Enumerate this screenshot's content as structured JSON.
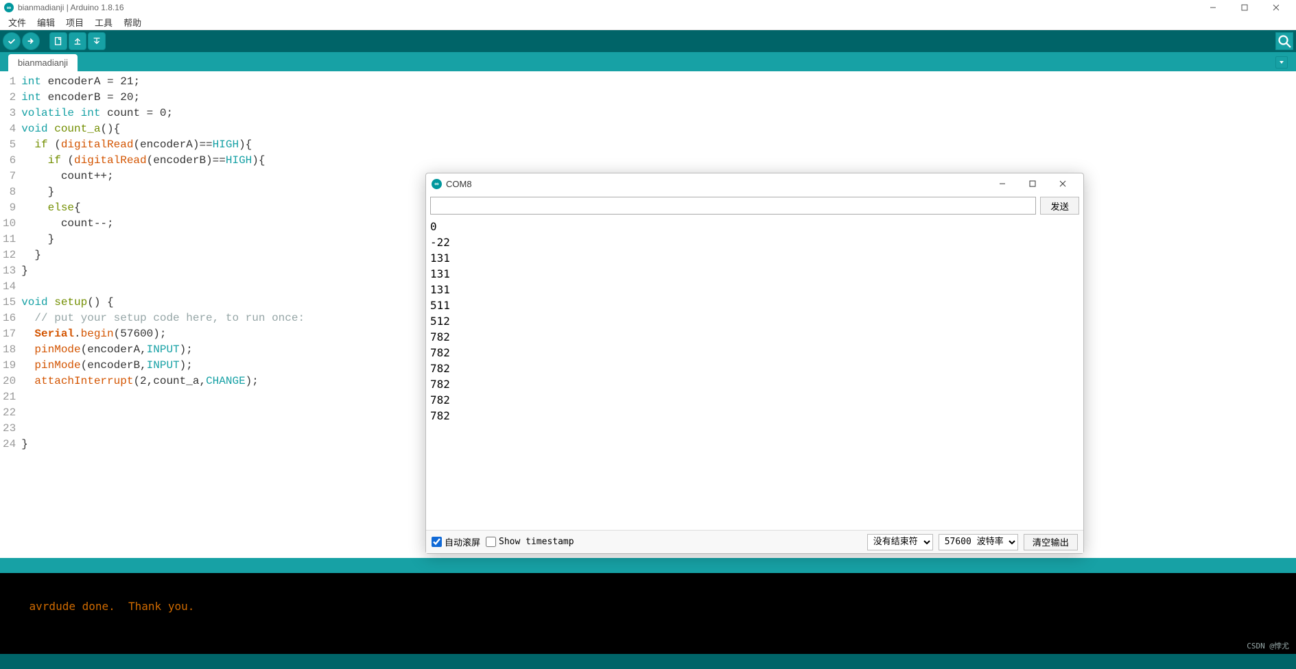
{
  "window": {
    "title": "bianmadianji | Arduino 1.8.16"
  },
  "menubar": {
    "file": "文件",
    "edit": "编辑",
    "sketch": "项目",
    "tools": "工具",
    "help": "帮助"
  },
  "toolbar_icons": {
    "verify": "verify-icon",
    "upload": "upload-icon",
    "new": "new-icon",
    "open": "open-icon",
    "save": "save-icon",
    "serial_monitor": "serial-monitor-icon"
  },
  "tab": {
    "name": "bianmadianji"
  },
  "code": {
    "lines": [
      {
        "n": 1,
        "html": "<span class='k-type'>int</span> encoderA = 21;"
      },
      {
        "n": 2,
        "html": "<span class='k-type'>int</span> encoderB = 20;"
      },
      {
        "n": 3,
        "html": "<span class='k-type'>volatile</span> <span class='k-type'>int</span> count = 0;"
      },
      {
        "n": 4,
        "html": "<span class='k-type'>void</span> <span class='k-kw'>count_a</span>(){"
      },
      {
        "n": 5,
        "html": "  <span class='k-kw'>if</span> (<span class='k-fn'>digitalRead</span>(encoderA)==<span class='k-const'>HIGH</span>){"
      },
      {
        "n": 6,
        "html": "    <span class='k-kw'>if</span> (<span class='k-fn'>digitalRead</span>(encoderB)==<span class='k-const'>HIGH</span>){"
      },
      {
        "n": 7,
        "html": "      count++;"
      },
      {
        "n": 8,
        "html": "    }"
      },
      {
        "n": 9,
        "html": "    <span class='k-kw'>else</span>{"
      },
      {
        "n": 10,
        "html": "      count--;"
      },
      {
        "n": 11,
        "html": "    }"
      },
      {
        "n": 12,
        "html": "  }"
      },
      {
        "n": 13,
        "html": "}"
      },
      {
        "n": 14,
        "html": ""
      },
      {
        "n": 15,
        "html": "<span class='k-type'>void</span> <span class='k-kw'>setup</span>() {"
      },
      {
        "n": 16,
        "html": "  <span class='k-comment'>// put your setup code here, to run once:</span>"
      },
      {
        "n": 17,
        "html": "  <span class='k-fn k-bold'>Serial</span>.<span class='k-fn'>begin</span>(57600);"
      },
      {
        "n": 18,
        "html": "  <span class='k-fn'>pinMode</span>(encoderA,<span class='k-const'>INPUT</span>);"
      },
      {
        "n": 19,
        "html": "  <span class='k-fn'>pinMode</span>(encoderB,<span class='k-const'>INPUT</span>);"
      },
      {
        "n": 20,
        "html": "  <span class='k-fn'>attachInterrupt</span>(2,count_a,<span class='k-const'>CHANGE</span>);"
      },
      {
        "n": 21,
        "html": ""
      },
      {
        "n": 22,
        "html": ""
      },
      {
        "n": 23,
        "html": ""
      },
      {
        "n": 24,
        "html": "}"
      }
    ]
  },
  "console_text": "avrdude done.  Thank you.",
  "serial": {
    "title": "COM8",
    "send_label": "发送",
    "output_lines": [
      "0",
      "-22",
      "131",
      "131",
      "131",
      "511",
      "512",
      "782",
      "782",
      "782",
      "782",
      "782",
      "782"
    ],
    "autoscroll_label": "自动滚屏",
    "autoscroll_checked": true,
    "timestamp_label": "Show timestamp",
    "timestamp_checked": false,
    "lineending_selected": "没有结束符",
    "baud_selected": "57600 波特率",
    "clear_label": "清空输出"
  },
  "watermark": "CSDN @悖尤"
}
